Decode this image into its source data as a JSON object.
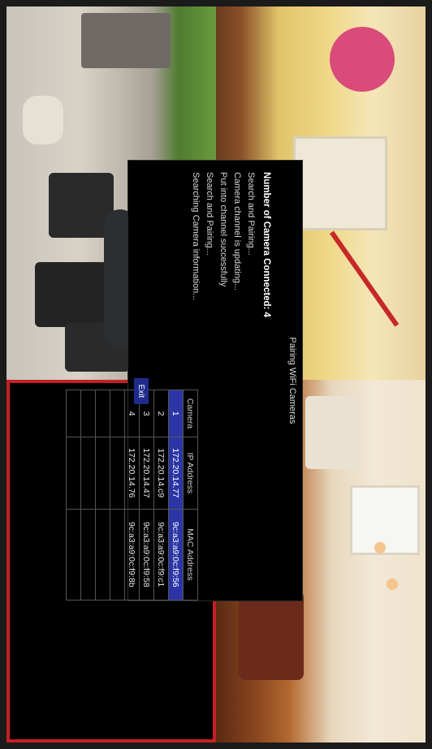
{
  "dialog": {
    "title": "Pairing WiFi Cameras",
    "status_lines": [
      "Number of Camera Connected: 4",
      "Search and Pairing...",
      "Camera channel is updating...",
      "Put into channel successfully",
      "Search and Pairing...",
      "Searching Camera information..."
    ],
    "table": {
      "headers": [
        "Camera",
        "IP Address",
        "MAC Address"
      ],
      "rows": [
        [
          "1",
          "172.20.14.77",
          "9c:a3:a9:0c:f9:56"
        ],
        [
          "2",
          "172.20.14.c9",
          "9c:a3:a9:0c:f9:c1"
        ],
        [
          "3",
          "172.20.14.47",
          "9c:a3:a9:0c:f9:58"
        ],
        [
          "4",
          "172.20.14.76",
          "9c:a3:a9:0c:f9:8b"
        ],
        [
          "",
          "",
          ""
        ],
        [
          "",
          "",
          ""
        ],
        [
          "",
          "",
          ""
        ],
        [
          "",
          "",
          ""
        ]
      ],
      "selected_row": 0
    },
    "exit_label": "Exit"
  },
  "colors": {
    "selection_blue": "#2b35a6",
    "button_blue": "#1f2b8c",
    "active_tile_border": "#c62026"
  }
}
